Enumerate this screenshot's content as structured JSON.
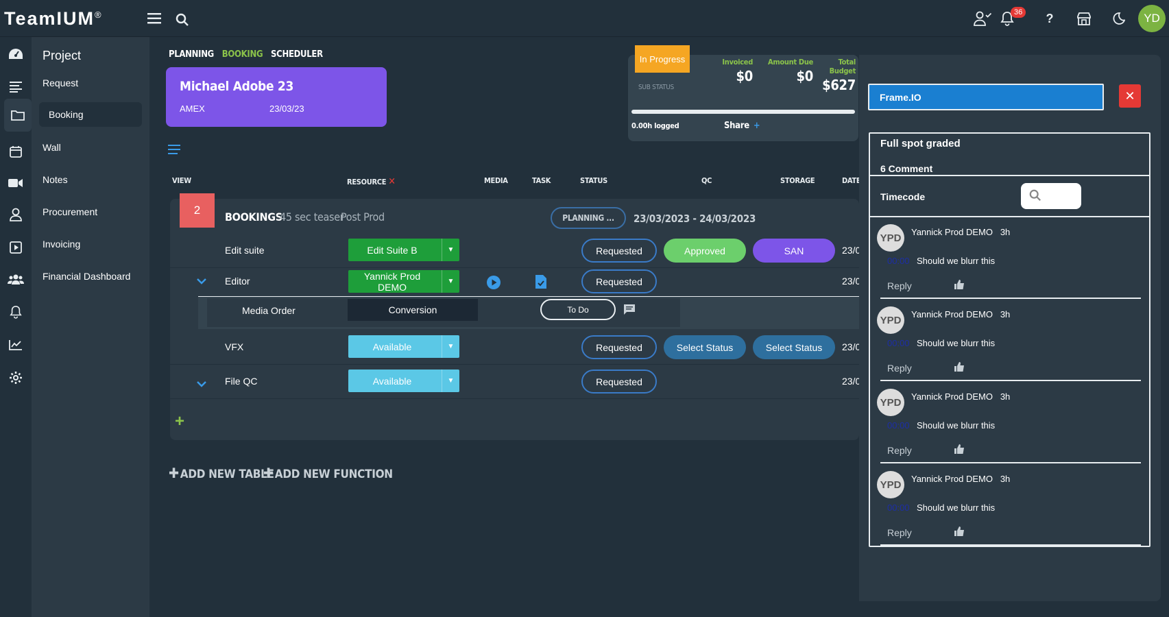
{
  "app": {
    "logo": "TeamIUM",
    "logo_mark": "®",
    "notification_count": "36",
    "user_initials": "YD"
  },
  "sidebar": {
    "title": "Project",
    "items": [
      {
        "label": "Request"
      },
      {
        "label": "Booking"
      },
      {
        "label": "Wall"
      },
      {
        "label": "Notes"
      },
      {
        "label": "Procurement"
      },
      {
        "label": "Invoicing"
      },
      {
        "label": "Financial Dashboard"
      }
    ]
  },
  "tabs": [
    {
      "label": "PLANNING"
    },
    {
      "label": "BOOKING"
    },
    {
      "label": "SCHEDULER"
    }
  ],
  "project_card": {
    "name": "Michael Adobe 23",
    "client": "AMEX",
    "date": "23/03/23"
  },
  "status_box": {
    "status": "In Progress",
    "sub_status": "SUB STATUS",
    "invoiced_label": "Invoiced",
    "invoiced_value": "$0",
    "amount_due_label": "Amount Due",
    "amount_due_value": "$0",
    "total_budget_label": "Total Budget",
    "total_budget_value": "$627",
    "logged": "0.00h logged",
    "share": "Share",
    "share_plus": "+"
  },
  "columns": {
    "view": "VIEW",
    "resource": "RESOURCE",
    "media": "MEDIA",
    "task": "TASK",
    "status": "STATUS",
    "qc": "QC",
    "storage": "STORAGE",
    "dates": "DATES"
  },
  "table": {
    "count": "2",
    "title": "BOOKINGS",
    "subtitle1": "45 sec teaser",
    "subtitle2": "Post Prod",
    "planning_pill": "PLANNING ...",
    "date_range": "23/03/2023 - 24/03/2023",
    "rows": [
      {
        "label": "Edit suite",
        "resource": "Edit Suite B",
        "status": "Requested",
        "qc": "Approved",
        "storage": "SAN",
        "date": "23/0"
      },
      {
        "label": "Editor",
        "resource": "Yannick Prod DEMO",
        "status": "Requested",
        "date": "23/0"
      },
      {
        "label": "VFX",
        "resource": "Available",
        "status": "Requested",
        "qc": "Select Status",
        "storage": "Select Status",
        "date": "23/0"
      },
      {
        "label": "File QC",
        "resource": "Available",
        "status": "Requested",
        "date": "23/0"
      }
    ],
    "media_order": {
      "label": "Media Order",
      "value": "Conversion",
      "status": "To Do"
    }
  },
  "actions": {
    "add_table": "ADD NEW TABLE",
    "add_function": "ADD NEW FUNCTION"
  },
  "right_panel": {
    "frameio": "Frame.IO",
    "close": "✕",
    "title": "Full spot graded",
    "comment_count": "6 Comment",
    "timecode_label": "Timecode",
    "comments": [
      {
        "initials": "YPD",
        "author": "Yannick Prod DEMO",
        "ago": "3h",
        "timecode": "00:00",
        "text": "Should we blurr this",
        "reply": "Reply"
      },
      {
        "initials": "YPD",
        "author": "Yannick Prod DEMO",
        "ago": "3h",
        "timecode": "00:00",
        "text": "Should we blurr this",
        "reply": "Reply"
      },
      {
        "initials": "YPD",
        "author": "Yannick Prod DEMO",
        "ago": "3h",
        "timecode": "00:00",
        "text": "Should we blurr this",
        "reply": "Reply"
      },
      {
        "initials": "YPD",
        "author": "Yannick Prod DEMO",
        "ago": "3h",
        "timecode": "00:00",
        "text": "Should we blurr this",
        "reply": "Reply"
      }
    ]
  },
  "colors": {
    "bg": "#22303b",
    "panel": "#2c3a45",
    "purple": "#7d55e8",
    "green": "#1e9e3a",
    "cyan": "#5bc8e6",
    "orange": "#f5a623",
    "red": "#e53935",
    "accent_green": "#8bc34a",
    "blue": "#3a9be8"
  }
}
